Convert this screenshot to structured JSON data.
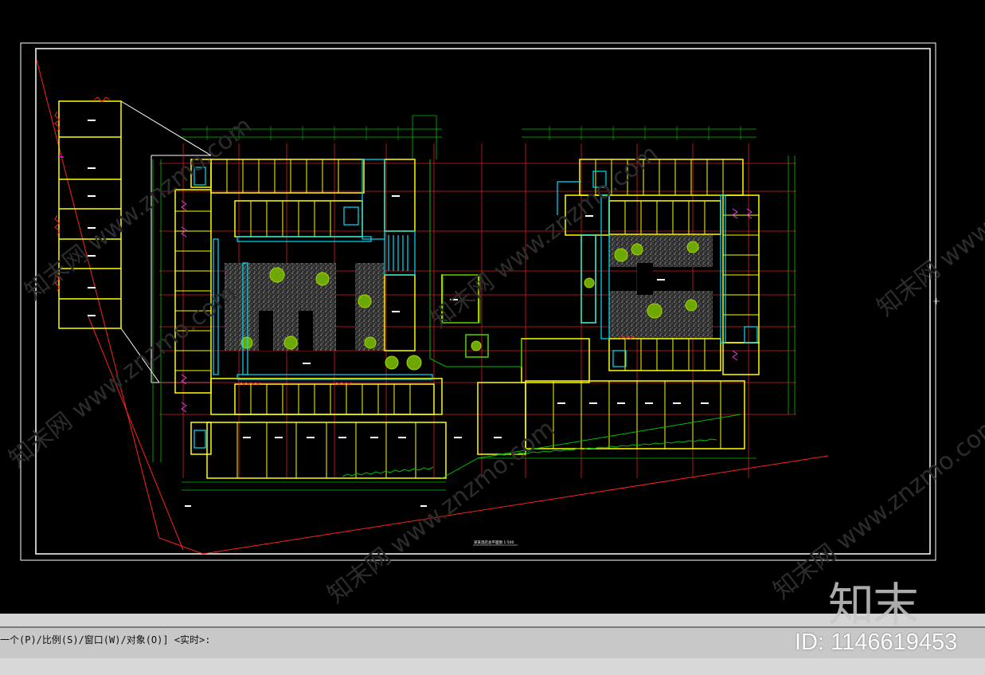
{
  "command_line": {
    "prompt": "一个(P)/比例(S)/窗口(W)/对象(O)] <实时>:"
  },
  "watermark": {
    "logo_text": "知末",
    "id_text": "ID: 1146619453",
    "site_text": "知末网 www.znzmo.com"
  },
  "drawing": {
    "plan_title": "某某酒店总平面图 1:500",
    "colors": {
      "background": "#000000",
      "frame": "#ffffff",
      "walls": "#ffff00",
      "grid": "#ff0000",
      "dimensions": "#00ff00",
      "windows": "#00ffff",
      "furniture": "#ff00ff",
      "landscape": "#7fbf00"
    }
  }
}
